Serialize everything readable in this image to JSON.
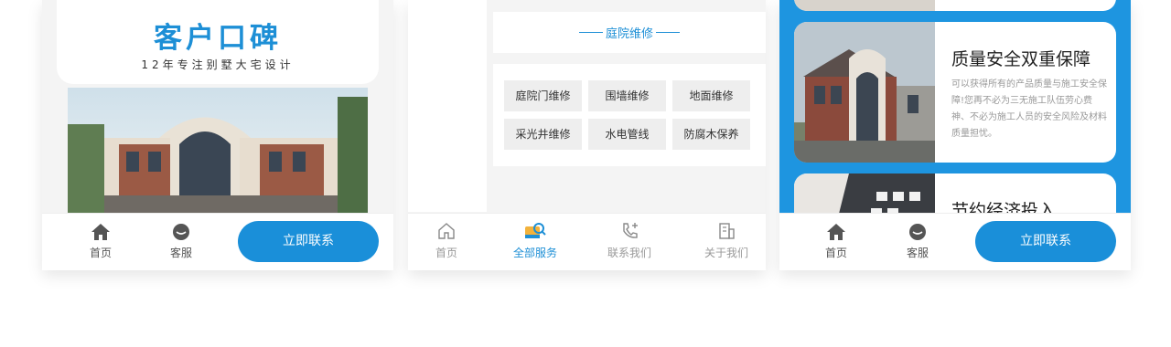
{
  "phone1": {
    "card": {
      "title": "客户口碑",
      "subtitle": "12年专注别墅大宅设计"
    },
    "tabbar": {
      "home": "首页",
      "service": "客服",
      "cta": "立即联系"
    }
  },
  "phone2": {
    "section_title": "庭院维修",
    "items": [
      "庭院门维修",
      "围墙维修",
      "地面维修",
      "采光井维修",
      "水电管线",
      "防腐木保养"
    ],
    "tabbar": [
      {
        "label": "首页",
        "icon": "home-outline-icon"
      },
      {
        "label": "全部服务",
        "icon": "services-icon",
        "active": true
      },
      {
        "label": "联系我们",
        "icon": "phone-icon"
      },
      {
        "label": "关于我们",
        "icon": "building-icon"
      }
    ]
  },
  "phone3": {
    "feature1": {
      "title": "质量安全双重保障",
      "text": "可以获得所有的产品质量与施工安全保障!您再不必为三无施工队伍劳心费神、不必为施工人员的安全风险及材料质量担忧。"
    },
    "feature2": {
      "title": "节约经济投入"
    },
    "tabbar": {
      "home": "首页",
      "service": "客服",
      "cta": "立即联系"
    }
  },
  "colors": {
    "brand_blue": "#1a8fd9",
    "panel_blue": "#1e95e0",
    "grey_bg": "#f4f4f4"
  }
}
